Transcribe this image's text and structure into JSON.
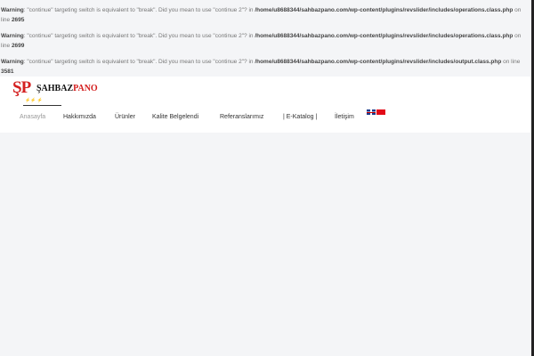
{
  "warnings": [
    {
      "label": "Warning",
      "message": ": \"continue\" targeting switch is equivalent to \"break\". Did you mean to use \"continue 2\"? in ",
      "path": "/home/u8688344/sahbazpano.com/wp-content/plugins/revslider/includes/operations.class.php",
      "on_line": " on line ",
      "line": "2695"
    },
    {
      "label": "Warning",
      "message": ": \"continue\" targeting switch is equivalent to \"break\". Did you mean to use \"continue 2\"? in ",
      "path": "/home/u8688344/sahbazpano.com/wp-content/plugins/revslider/includes/operations.class.php",
      "on_line": " on line ",
      "line": "2699"
    },
    {
      "label": "Warning",
      "message": ": \"continue\" targeting switch is equivalent to \"break\". Did you mean to use \"continue 2\"? in ",
      "path": "/home/u8688344/sahbazpano.com/wp-content/plugins/revslider/includes/output.class.php",
      "on_line": " on line ",
      "line": "3581"
    }
  ],
  "logo": {
    "mark_s": "Ş",
    "mark_p": "P",
    "name_black": "ŞAHBAZ",
    "name_red": "PANO"
  },
  "nav": [
    {
      "label": "Anasayfa"
    },
    {
      "label": "Hakkımızda"
    },
    {
      "label": "Ürünler"
    },
    {
      "label": "Kalite Belgelendi"
    },
    {
      "label": "Referanslarımız"
    },
    {
      "label": "| E-Katalog |"
    },
    {
      "label": "İletişim"
    }
  ],
  "languages": [
    "English",
    "Türkçe"
  ],
  "colors": {
    "brand_red": "#d42020",
    "background": "#f4f5f7"
  }
}
